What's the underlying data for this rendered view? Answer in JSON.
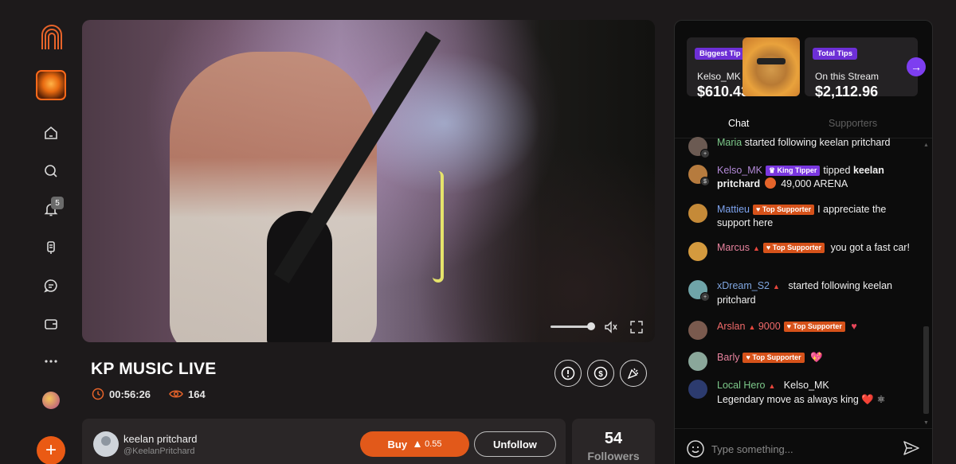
{
  "sidebar": {
    "notification_count": "5"
  },
  "stream": {
    "title": "KP MUSIC LIVE",
    "duration": "00:56:26",
    "viewers": "164"
  },
  "creator": {
    "name": "keelan pritchard",
    "handle": "@KeelanPritchard",
    "buy_label": "Buy",
    "buy_price": "0.55",
    "unfollow_label": "Unfollow",
    "followers_count": "54",
    "followers_label": "Followers"
  },
  "tips": {
    "biggest": {
      "tag": "Biggest Tip",
      "name": "Kelso_MK",
      "value": "$610.43"
    },
    "total": {
      "tag": "Total Tips",
      "name": "On this Stream",
      "value": "$2,112.96"
    }
  },
  "tabs": {
    "chat": "Chat",
    "supporters": "Supporters"
  },
  "chat": {
    "messages": [
      {
        "user": "Maria",
        "text": "started following keelan pritchard"
      },
      {
        "user": "Kelso_MK",
        "badge": "♛ King Tipper",
        "text": "tipped",
        "target": "keelan pritchard",
        "amount": "49,000 ARENA"
      },
      {
        "user": "Mattieu",
        "badge": "♥ Top Supporter",
        "text": "I appreciate the support here"
      },
      {
        "user": "Marcus",
        "badge": "♥ Top Supporter",
        "text": "you got a fast car!"
      },
      {
        "user": "xDream_S2",
        "text": "started following keelan pritchard"
      },
      {
        "user": "Arslan",
        "score": "9000",
        "badge": "♥ Top Supporter",
        "text": "♥"
      },
      {
        "user": "Barly",
        "badge": "♥ Top Supporter",
        "text": "💖"
      },
      {
        "user": "Local Hero",
        "mention": "Kelso_MK",
        "text": "Legendary move as always king",
        "emojis": "❤️ ⚛"
      }
    ],
    "input_placeholder": "Type something..."
  },
  "colors": {
    "accent": "#e2591a",
    "purple": "#6d2fd6",
    "bg": "#1d1a1b",
    "panel": "#0c0c0c"
  }
}
